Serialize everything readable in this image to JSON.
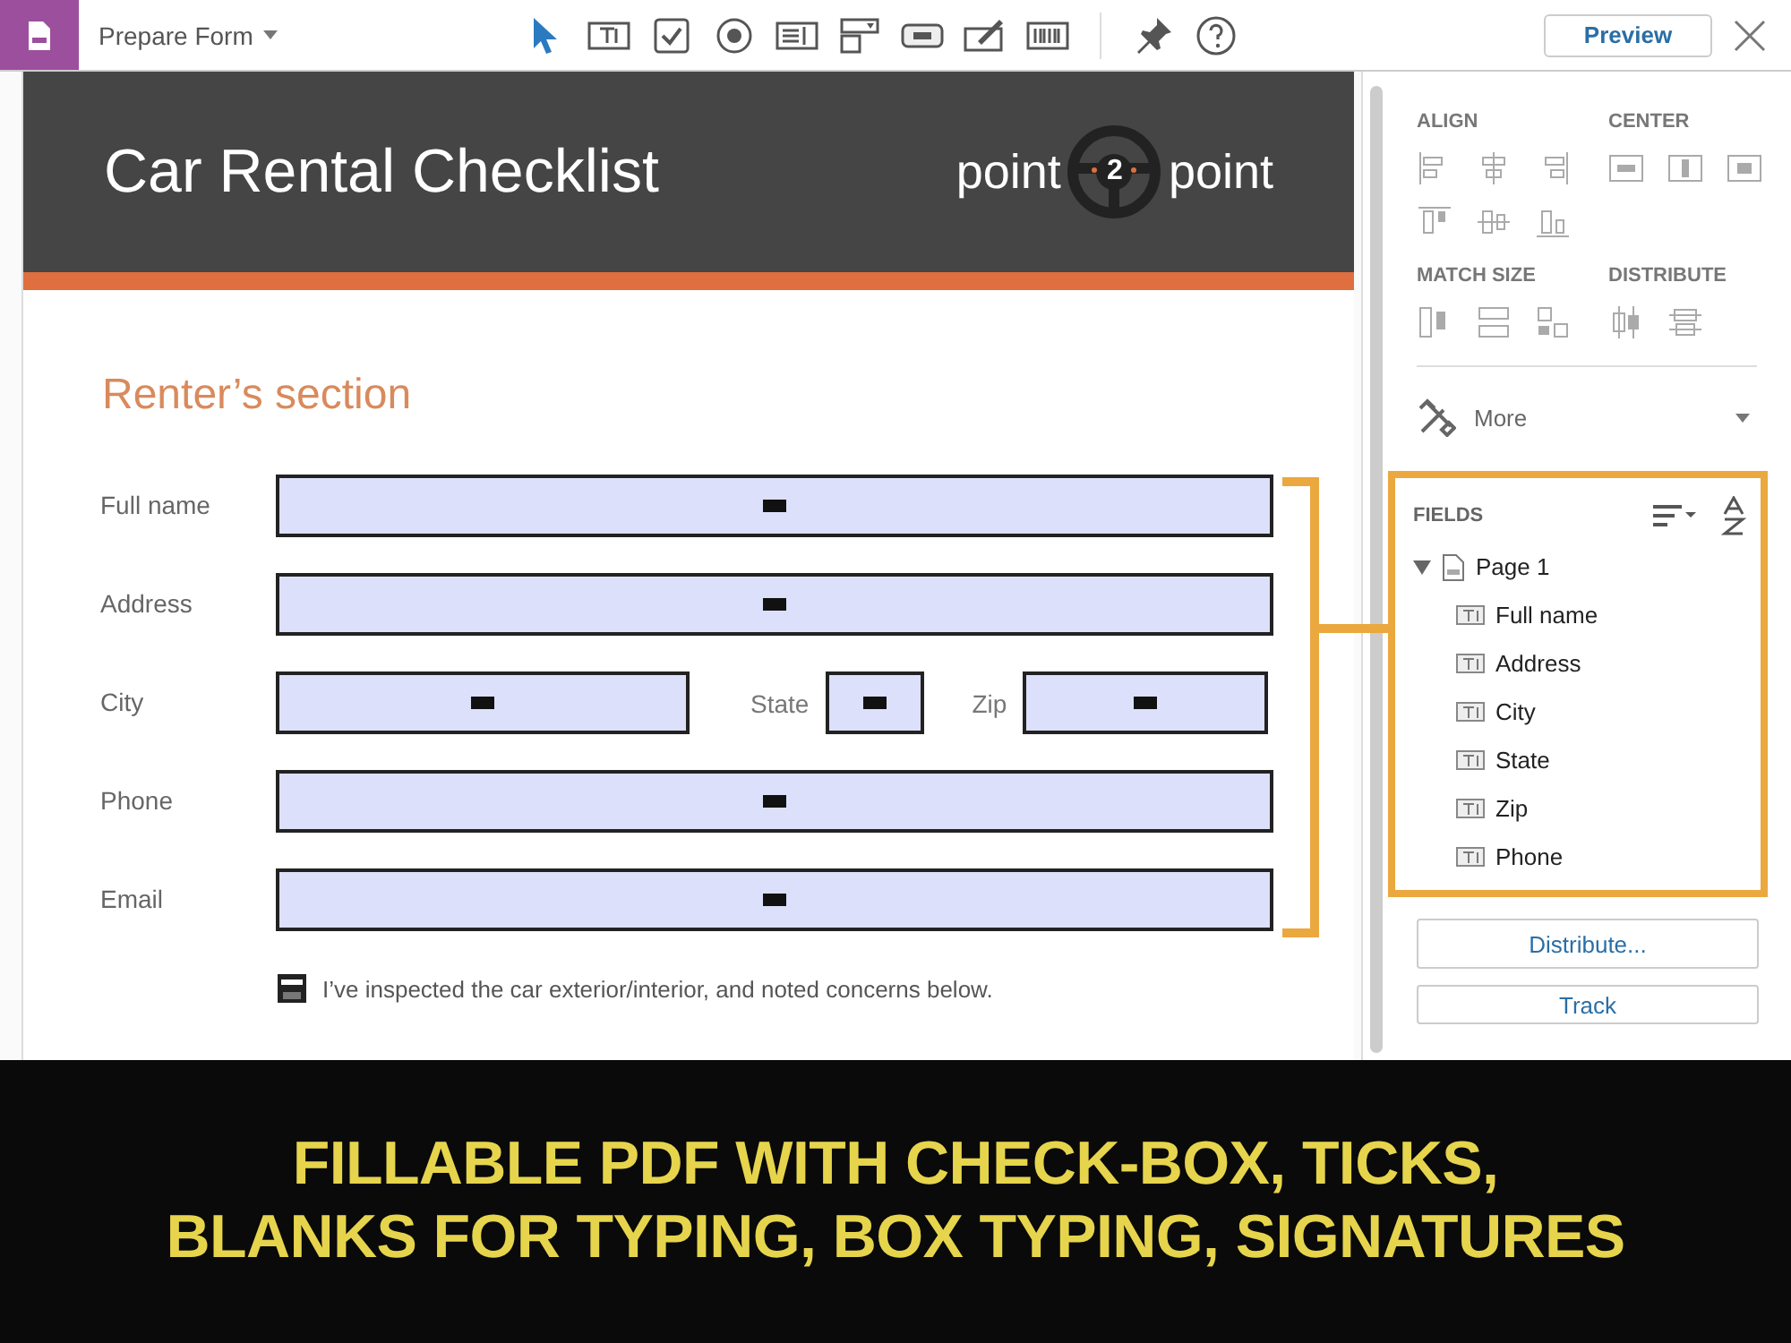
{
  "toolbar": {
    "title": "Prepare Form",
    "preview": "Preview"
  },
  "document": {
    "title": "Car Rental Checklist",
    "logo": {
      "left": "point",
      "middle": "2",
      "right": "point"
    },
    "section": "Renter’s section",
    "rows": [
      {
        "fields": [
          {
            "label": "Full name"
          }
        ]
      },
      {
        "fields": [
          {
            "label": "Address"
          }
        ]
      },
      {
        "fields": [
          {
            "label": "City"
          },
          {
            "label": "State"
          },
          {
            "label": "Zip"
          }
        ]
      },
      {
        "fields": [
          {
            "label": "Phone"
          }
        ]
      },
      {
        "fields": [
          {
            "label": "Email"
          }
        ]
      }
    ],
    "note": "I’ve inspected the car exterior/interior, and noted concerns below."
  },
  "panel": {
    "groups": [
      {
        "title": "ALIGN"
      },
      {
        "title": "CENTER"
      },
      {
        "title": "MATCH SIZE"
      },
      {
        "title": "DISTRIBUTE"
      }
    ],
    "more": "More",
    "fields": {
      "title": "FIELDS",
      "tree": [
        {
          "label": "Page 1",
          "expanded": true,
          "children": [
            {
              "label": "Full name"
            },
            {
              "label": "Address"
            },
            {
              "label": "City"
            },
            {
              "label": "State"
            },
            {
              "label": "Zip"
            },
            {
              "label": "Phone"
            }
          ]
        }
      ]
    },
    "buttons": [
      "Distribute...",
      "Track"
    ]
  },
  "caption": [
    "FILLABLE PDF WITH CHECK-BOX, TICKS,",
    "BLANKS FOR TYPING, BOX TYPING, SIGNATURES"
  ]
}
